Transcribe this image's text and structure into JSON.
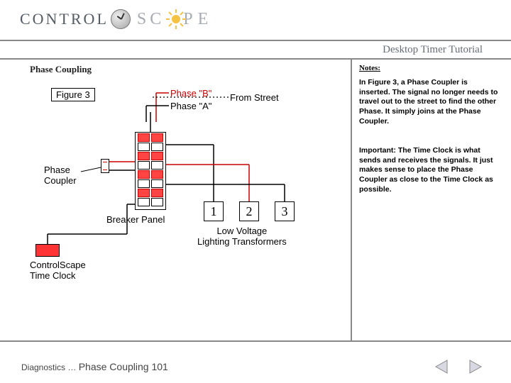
{
  "logo": {
    "left": "CONTROL",
    "right": "SCAPE"
  },
  "header": {
    "subtitle": "Desktop Timer Tutorial"
  },
  "section": {
    "title": "Phase Coupling"
  },
  "diagram": {
    "figure": "Figure 3",
    "phase_b": "Phase \"B\"",
    "phase_a": "Phase \"A\"",
    "from_street": "From Street",
    "phase_coupler": "Phase\nCoupler",
    "breaker_panel": "Breaker Panel",
    "time_clock": "ControlScape\nTime Clock",
    "transformers": [
      "1",
      "2",
      "3"
    ],
    "lv_label": "Low Voltage\nLighting Transformers"
  },
  "notes": {
    "head": "Notes:",
    "p1": "In Figure 3, a Phase Coupler is inserted. The signal no longer needs to travel out to the street to find the other Phase. It simply joins at the Phase Coupler.",
    "p2": "Important: The Time Clock is what sends and receives the signals. It just makes sense to place the Phase Coupler as close to the Time Clock as possible."
  },
  "footer": {
    "crumb_prev": "Diagnostics",
    "sep": "…",
    "crumb_cur": "Phase Coupling 101"
  }
}
